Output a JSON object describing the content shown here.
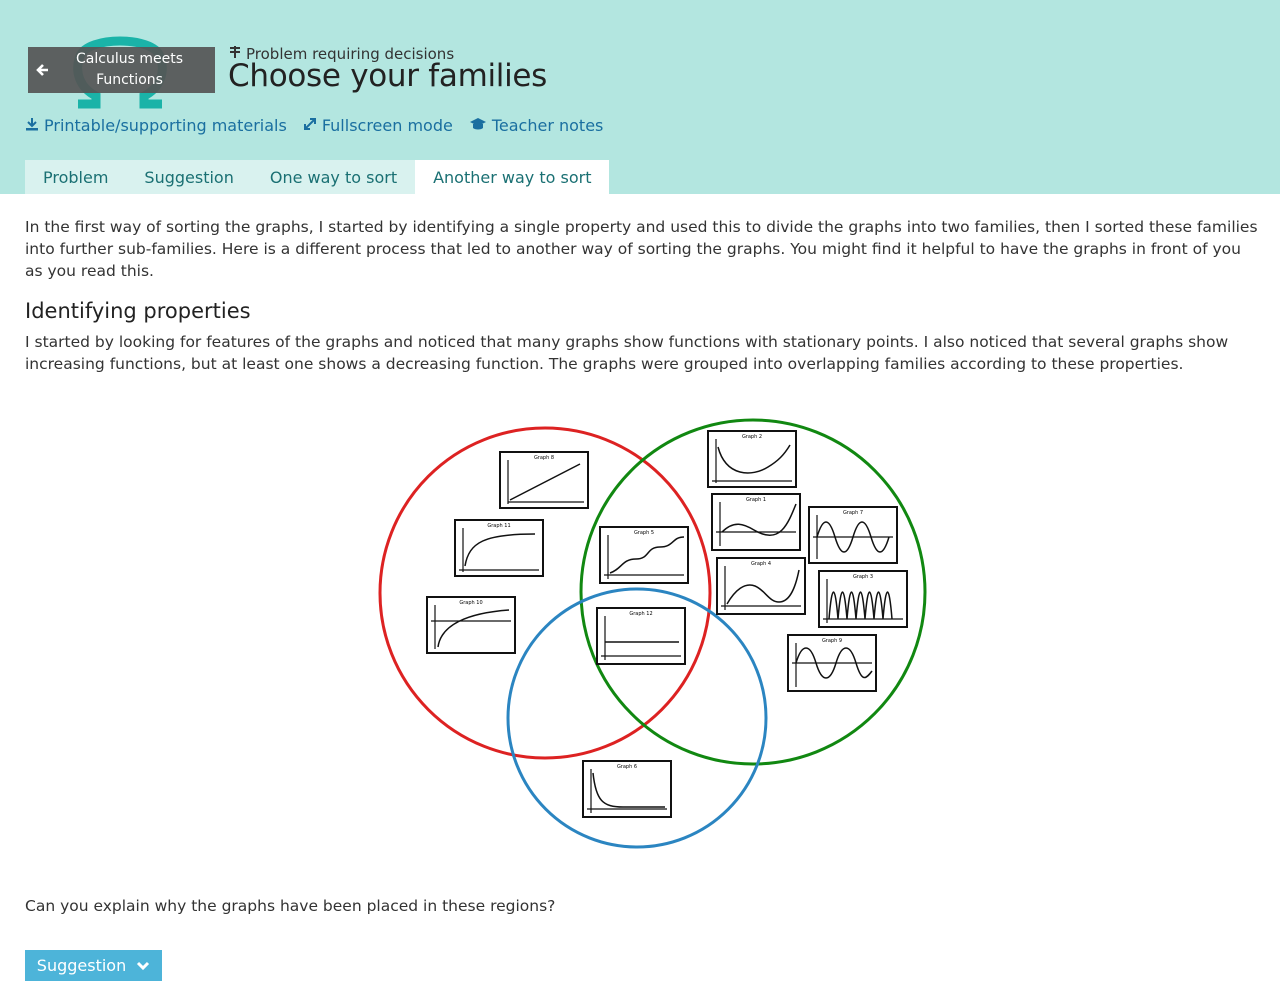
{
  "colors": {
    "header_bg": "#b3e6e0",
    "link": "#1a6fa0",
    "tab_text": "#1a7073",
    "button_bg": "#4db4d9"
  },
  "back_button": {
    "label": "Calculus meets Functions",
    "icon": "arrow-left-icon"
  },
  "breadcrumb": {
    "label": "Problem requiring decisions",
    "icon": "signpost-icon"
  },
  "page_title": "Choose your families",
  "links": [
    {
      "label": "Printable/supporting materials",
      "icon": "download-icon"
    },
    {
      "label": "Fullscreen mode",
      "icon": "expand-icon"
    },
    {
      "label": "Teacher notes",
      "icon": "graduation-cap-icon"
    }
  ],
  "tabs": [
    {
      "label": "Problem",
      "active": false
    },
    {
      "label": "Suggestion",
      "active": false
    },
    {
      "label": "One way to sort",
      "active": false
    },
    {
      "label": "Another way to sort",
      "active": true
    }
  ],
  "intro": "In the first way of sorting the graphs, I started by identifying a single property and used this to divide the graphs into two families, then I sorted these families into further sub-families. Here is a different process that led to another way of sorting the graphs. You might find it helpful to have the graphs in front of you as you read this.",
  "section_heading": "Identifying properties",
  "section_text": "I started by looking for features of the graphs and noticed that many graphs show functions with stationary points. I also noticed that several graphs show increasing functions, but at least one shows a decreasing function. The graphs were grouped into overlapping families according to these properties.",
  "venn": {
    "circle_colors": [
      "#dd2222",
      "#118811",
      "#2b85c1"
    ],
    "graphs": [
      "Graph 8",
      "Graph 11",
      "Graph 10",
      "Graph 5",
      "Graph 12",
      "Graph 2",
      "Graph 1",
      "Graph 7",
      "Graph 4",
      "Graph 3",
      "Graph 9",
      "Graph 6"
    ]
  },
  "question": "Can you explain why the graphs have been placed in these regions?",
  "suggestion_button": {
    "label": "Suggestion",
    "icon": "chevron-down-icon"
  }
}
